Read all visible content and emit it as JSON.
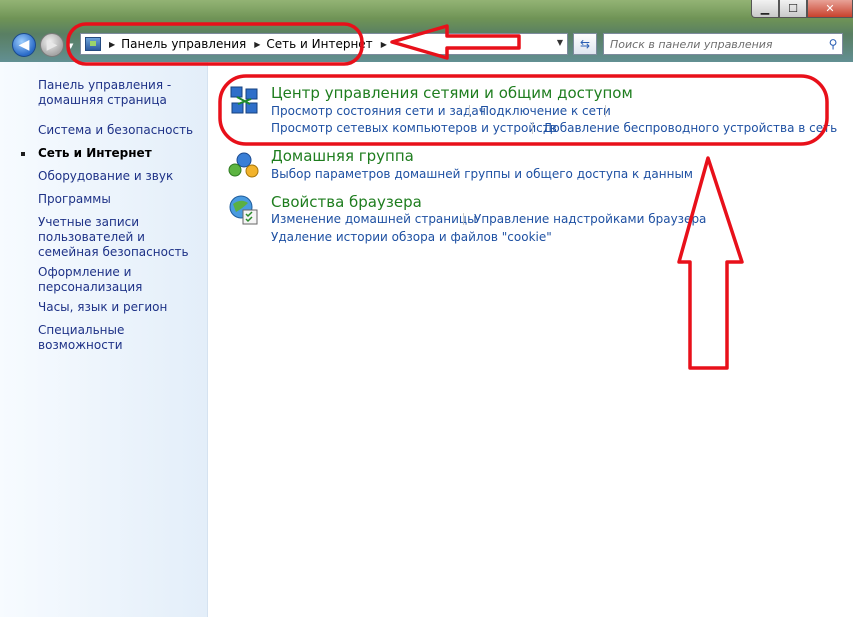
{
  "window": {
    "minimize_glyph": "▁",
    "maximize_glyph": "☐",
    "close_glyph": "✕"
  },
  "nav": {
    "back_glyph": "◀",
    "forward_glyph": "▶",
    "dropdown_glyph": "▼"
  },
  "address": {
    "breadcrumbs": [
      "Панель управления",
      "Сеть и Интернет"
    ],
    "separator_glyph": "▶",
    "dropdown_glyph": "▼"
  },
  "refresh_glyph": "⇆",
  "search": {
    "placeholder": "Поиск в панели управления",
    "icon_glyph": "⚲"
  },
  "sidebar": {
    "items": [
      {
        "label": "Панель управления - домашняя страница"
      },
      {
        "label": "Система и безопасность"
      },
      {
        "label": "Сеть и Интернет",
        "current": true
      },
      {
        "label": "Оборудование и звук"
      },
      {
        "label": "Программы"
      },
      {
        "label": "Учетные записи пользователей и семейная безопасность"
      },
      {
        "label": "Оформление и персонализация"
      },
      {
        "label": "Часы, язык и регион"
      },
      {
        "label": "Специальные возможности"
      }
    ]
  },
  "categories": [
    {
      "title": "Центр управления сетями и общим доступом",
      "links": [
        "Просмотр состояния сети и задач",
        "Подключение к сети",
        "Просмотр сетевых компьютеров и устройств",
        "Добавление беспроводного устройства в сеть"
      ]
    },
    {
      "title": "Домашняя группа",
      "links": [
        "Выбор параметров домашней группы и общего доступа к данным"
      ]
    },
    {
      "title": "Свойства браузера",
      "links": [
        "Изменение домашней страницы",
        "Управление надстройками браузера",
        "Удаление истории обзора и файлов \"cookie\""
      ]
    }
  ],
  "colors": {
    "annotation_red": "#e8101a",
    "link_blue": "#1e50a2",
    "title_green": "#1e7d1e",
    "sidebar_blue": "#1e3287"
  }
}
